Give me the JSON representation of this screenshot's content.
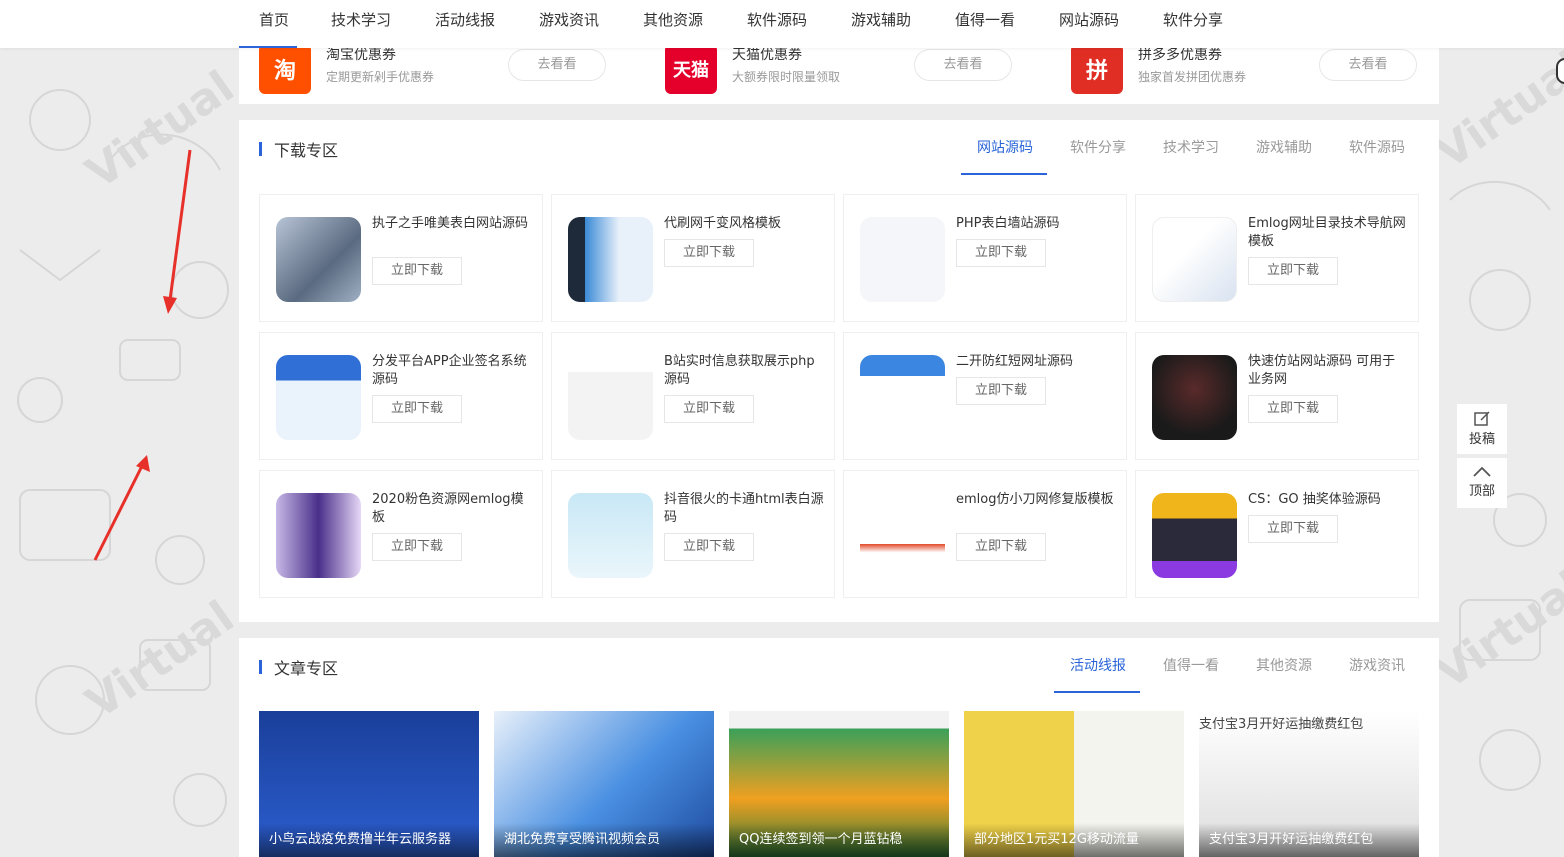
{
  "nav": {
    "items": [
      "首页",
      "技术学习",
      "活动线报",
      "游戏资讯",
      "其他资源",
      "软件源码",
      "游戏辅助",
      "值得一看",
      "网站源码",
      "软件分享"
    ]
  },
  "coupons": [
    {
      "logo": "淘",
      "name": "淘宝优惠券",
      "desc": "定期更新剁手优惠券",
      "button": "去看看",
      "color": "#ff5000"
    },
    {
      "logo": "天猫",
      "name": "天猫优惠券",
      "desc": "大额券限时限量领取",
      "button": "去看看",
      "color": "#e4002b"
    },
    {
      "logo": "拼",
      "name": "拼多多优惠券",
      "desc": "独家首发拼团优惠券",
      "button": "去看看",
      "color": "#e02e24"
    }
  ],
  "download": {
    "title": "下载专区",
    "tabs": [
      "网站源码",
      "软件分享",
      "技术学习",
      "游戏辅助",
      "软件源码"
    ],
    "active_tab": "网站源码",
    "button_label": "立即下载",
    "cards": [
      {
        "title": "执子之手唯美表白网站源码"
      },
      {
        "title": "代刷网千变风格模板"
      },
      {
        "title": "PHP表白墙站源码"
      },
      {
        "title": "Emlog网址目录技术导航网模板"
      },
      {
        "title": "分发平台APP企业签名系统源码"
      },
      {
        "title": "B站实时信息获取展示php源码"
      },
      {
        "title": "二开防红短网址源码"
      },
      {
        "title": "快速仿站网站源码 可用于业务网"
      },
      {
        "title": "2020粉色资源网emlog模板"
      },
      {
        "title": "抖音很火的卡通html表白源码"
      },
      {
        "title": "emlog仿小刀网修复版模板"
      },
      {
        "title": "CS：GO 抽奖体验源码"
      }
    ]
  },
  "articles": {
    "title": "文章专区",
    "tabs": [
      "活动线报",
      "值得一看",
      "其他资源",
      "游戏资讯"
    ],
    "active_tab": "活动线报",
    "items": [
      {
        "caption": "小鸟云战疫免费撸半年云服务器"
      },
      {
        "caption": "湖北免费享受腾讯视频会员"
      },
      {
        "caption": "QQ连续签到领一个月蓝钻稳"
      },
      {
        "caption": "部分地区1元买12G移动流量"
      },
      {
        "caption": "支付宝3月开好运抽缴费红包",
        "alt": "支付宝3月开好运抽缴费红包"
      }
    ]
  },
  "side": {
    "submit": "投稿",
    "top": "顶部"
  },
  "colors": {
    "accent": "#2a64d8",
    "annotation_arrow": "#e8302a"
  }
}
